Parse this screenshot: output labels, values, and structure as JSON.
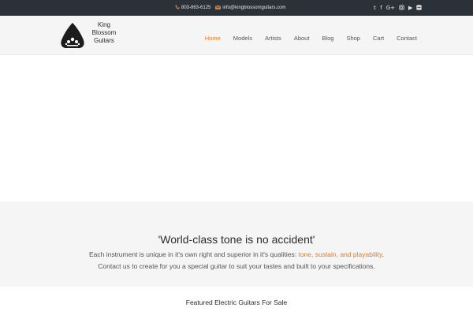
{
  "topbar": {
    "phone": "803-863-6125",
    "email": "info@kingblossomguitars.com",
    "social_icons": [
      "twitter-icon",
      "facebook-icon",
      "google-plus-icon",
      "instagram-icon",
      "youtube-icon",
      "flickr-icon"
    ],
    "social_glyphs": {
      "twitter": "𝕥",
      "facebook": "f",
      "google_plus": "G+",
      "youtube": "▶"
    }
  },
  "logo": {
    "line1": "King",
    "line2": "Blossom",
    "line3": "Guitars"
  },
  "nav": {
    "items": [
      "Home",
      "Models",
      "Artists",
      "About",
      "Blog",
      "Shop",
      "Cart",
      "Contact"
    ]
  },
  "tagline": {
    "heading": "'World-class tone is no accident'",
    "line1_before": "Each instrument is unique in it's own right and superior in it's qualities: ",
    "line1_highlight": "tone, sustain, and playability",
    "line1_after": ".",
    "line2": "Contact us to create for you a special guitar to suit your tastes and built to your specifications."
  },
  "featured": {
    "title": "Featured Electric Guitars For Sale"
  },
  "colors": {
    "accent": "#e07b27",
    "topbar_bg": "#2b3138",
    "header_bg": "#f5f5f5"
  }
}
